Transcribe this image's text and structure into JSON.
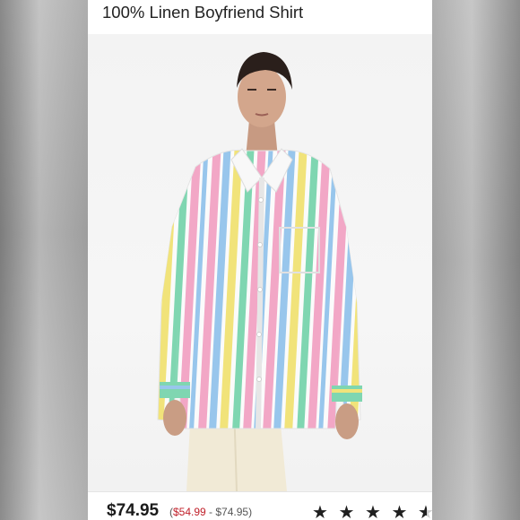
{
  "product": {
    "title": "100% Linen Boyfriend Shirt",
    "price": "$74.95",
    "range_open": "(",
    "sale_price": "$54.99",
    "range_rest": " - $74.95)",
    "rating": 4.5,
    "rating_max": 5
  },
  "colors": {
    "sale": "#c0202a",
    "stripe_pink": "#f2a7c6",
    "stripe_blue": "#98c6ec",
    "stripe_green": "#7fd6b1",
    "stripe_yellow": "#f1e37a",
    "pants": "#f1ead6"
  },
  "icons": {
    "star": "★"
  }
}
